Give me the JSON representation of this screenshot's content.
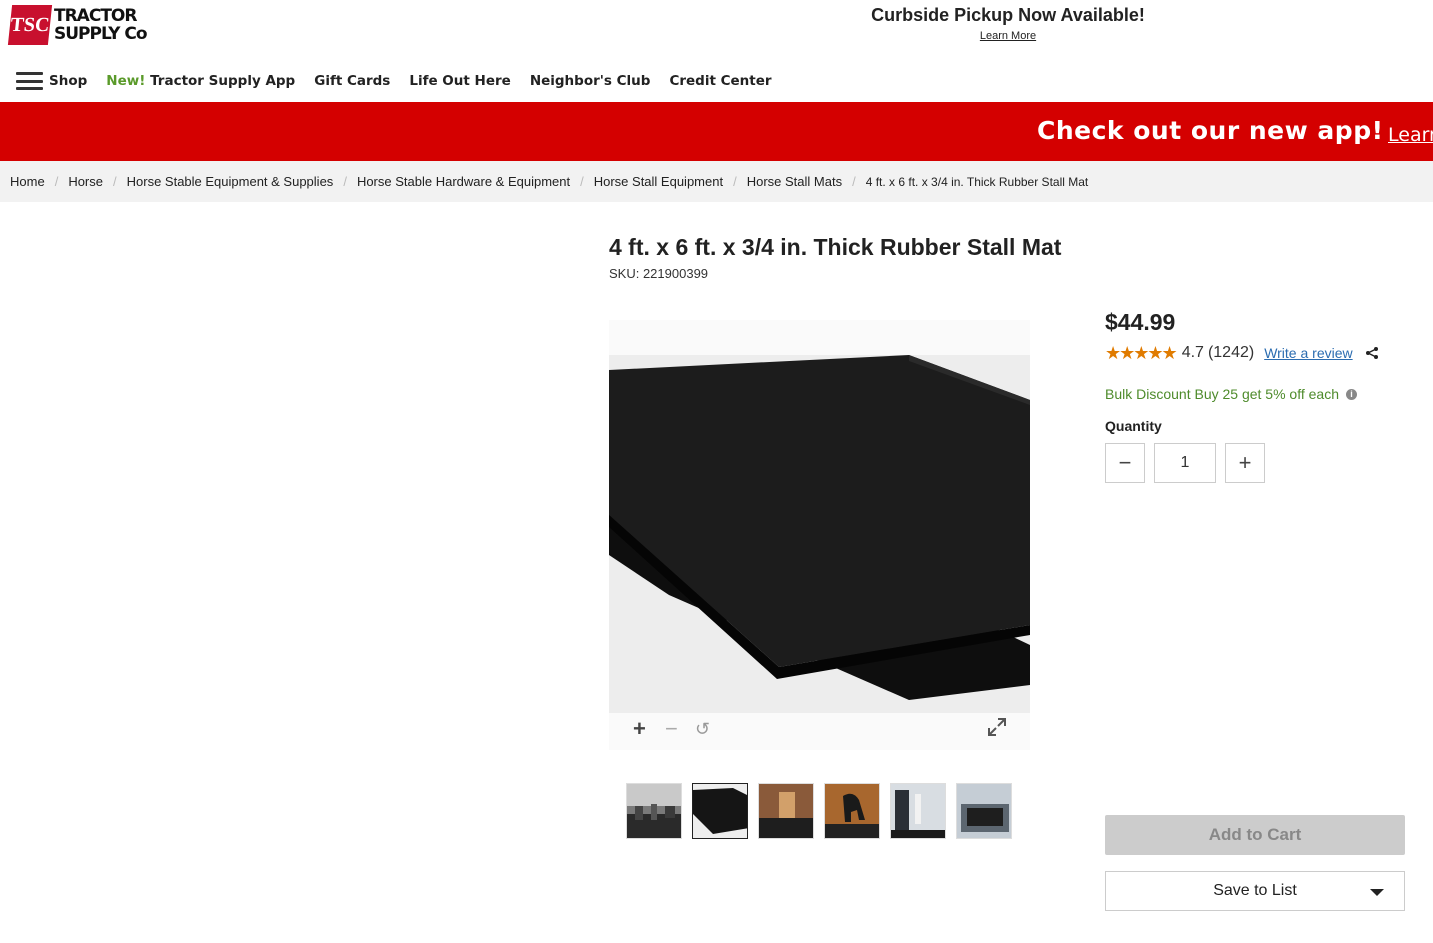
{
  "header": {
    "logo_badge": "TSC",
    "logo_line1": "TRACTOR",
    "logo_line2": "SUPPLY Co",
    "promo_title": "Curbside Pickup Now Available!",
    "promo_link": "Learn More"
  },
  "nav": {
    "shop": "Shop",
    "app_new": "New!",
    "app_label": "Tractor Supply App",
    "gift_cards": "Gift Cards",
    "life_out_here": "Life Out Here",
    "neighbors_club": "Neighbor's Club",
    "credit_center": "Credit Center"
  },
  "banner": {
    "text": "Check out our new app!",
    "link": "Learn"
  },
  "breadcrumb": {
    "items": [
      "Home",
      "Horse",
      "Horse Stable Equipment & Supplies",
      "Horse Stable Hardware & Equipment",
      "Horse Stall Equipment",
      "Horse Stall Mats"
    ],
    "current": "4 ft. x 6 ft. x 3/4 in. Thick Rubber Stall Mat"
  },
  "product": {
    "title": "4 ft. x 6 ft. x 3/4 in. Thick Rubber Stall Mat",
    "sku": "SKU: 221900399",
    "price": "$44.99",
    "stars": "★★★★★",
    "rating": "4.7",
    "review_count": "(1242)",
    "write_review": "Write a review",
    "bulk_discount": "Bulk Discount Buy 25 get 5% off each",
    "quantity_label": "Quantity",
    "quantity_value": "1",
    "add_to_cart": "Add to Cart",
    "save_to_list": "Save to List",
    "thumbnail_count": 6,
    "active_thumbnail": 2
  },
  "colors": {
    "brand_red": "#d40000",
    "new_green": "#5a9a2a",
    "star_orange": "#e07b00",
    "discount_green": "#4e8b2b",
    "link_blue": "#2b6cb0"
  },
  "icons": {
    "menu": "hamburger-icon",
    "share": "share-icon",
    "info": "info-icon",
    "zoom_in": "plus-icon",
    "zoom_out": "minus-icon",
    "reset": "rotate-icon",
    "fullscreen": "expand-icon",
    "dropdown": "caret-down-icon"
  }
}
